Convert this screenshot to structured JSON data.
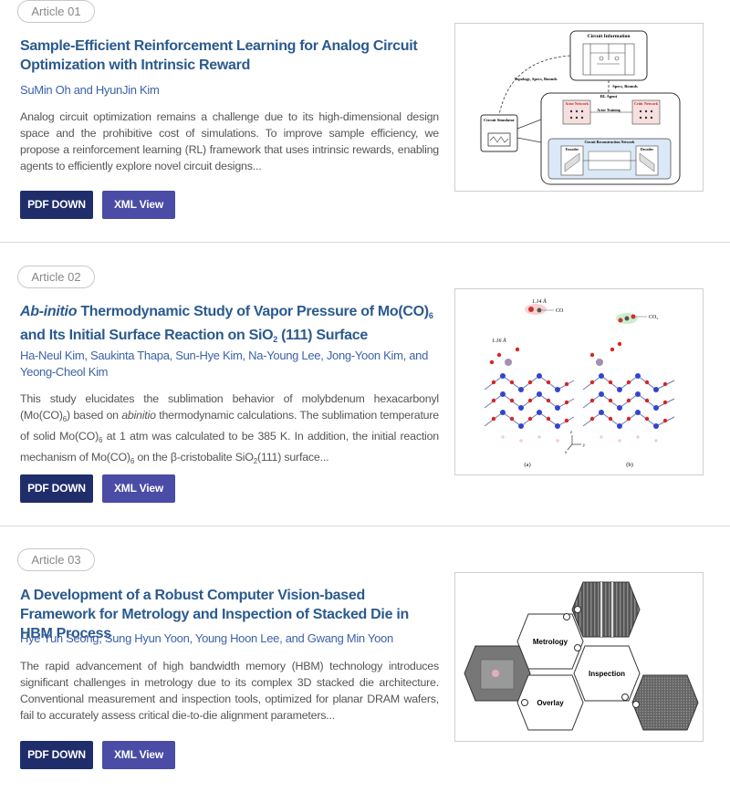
{
  "articles": [
    {
      "badge": "Article 01",
      "title": "Sample-Efficient Reinforcement Learning for Analog Circuit Optimization with Intrinsic Reward",
      "authors": "SuMin Oh and HyunJin Kim",
      "abstract": "Analog circuit optimization remains a challenge due to its high-dimensional design space and the prohibitive cost of simulations. To improve sample efficiency, we propose a reinforcement learning (RL) framework that uses intrinsic rewards, enabling agents to efficiently explore novel circuit designs...",
      "pdf_label": "PDF DOWN",
      "xml_label": "XML View",
      "figure": {
        "circuit_information": "Circuit Information",
        "topology_specs_bounds": "Topology, Specs, Bounds",
        "specs_bounds": "Specs, Bounds",
        "rl_agent": "RL Agent",
        "actor_network": "Actor Network",
        "critic_network": "Critic Network",
        "actor_training": "Actor Training",
        "circuit_simulator": "Circuit Simulator",
        "circuit_reconstruction_network": "Circuit Reconstruction Network",
        "encoder": "Encoder",
        "decoder": "Decoder"
      }
    },
    {
      "badge": "Article 02",
      "title_italic": "Ab-initio",
      "title_part1": " Thermodynamic Study of Vapor Pressure of Mo(CO)",
      "title_sub1": "6",
      "title_part2": " and Its Initial Surface Reaction on SiO",
      "title_sub2": "2",
      "title_part3": " (111) Surface",
      "authors": "Ha-Neul Kim, Saukinta Thapa, Sun-Hye Kim, Na-Young Lee, Jong-Yoon Kim, and Yeong-Cheol Kim",
      "abstract_p1": "This study elucidates the sublimation behavior of molybdenum hexacarbonyl (Mo(CO)",
      "abstract_sub1": "6",
      "abstract_p2": ") based on ",
      "abstract_italic": "abinitio",
      "abstract_p3": " thermodynamic calculations. The sublimation temperature of solid Mo(CO)",
      "abstract_sub2": "6",
      "abstract_p4": " at 1 atm was calculated to be 385 K. In addition, the initial reaction mechanism of Mo(CO)",
      "abstract_sub3": "6",
      "abstract_p5": " on the β-cristobalite SiO",
      "abstract_sub4": "2",
      "abstract_p6": "(111) surface...",
      "pdf_label": "PDF DOWN",
      "xml_label": "XML View",
      "figure": {
        "label_a": "(a)",
        "label_b": "(b)",
        "dist1": "1.14 Å",
        "dist2": "1.16 Å",
        "co": "CO",
        "co2": "CO₂",
        "axis_x": "x",
        "axis_y": "y",
        "axis_z": "z"
      }
    },
    {
      "badge": "Article 03",
      "title": "A Development of a Robust Computer Vision-based Framework for Metrology and Inspection of Stacked Die in HBM Process",
      "authors": "Hye Yun Seong, Sung Hyun Yoon, Young Hoon Lee, and Gwang Min Yoon",
      "abstract": "The rapid advancement of high bandwidth memory (HBM) technology introduces significant challenges in metrology due to its complex 3D stacked die architecture. Conventional measurement and inspection tools, optimized for planar DRAM wafers, fail to accurately assess critical die-to-die alignment parameters...",
      "pdf_label": "PDF DOWN",
      "xml_label": "XML View",
      "figure": {
        "metrology": "Metrology",
        "inspection": "Inspection",
        "overlay": "Overlay"
      }
    }
  ]
}
